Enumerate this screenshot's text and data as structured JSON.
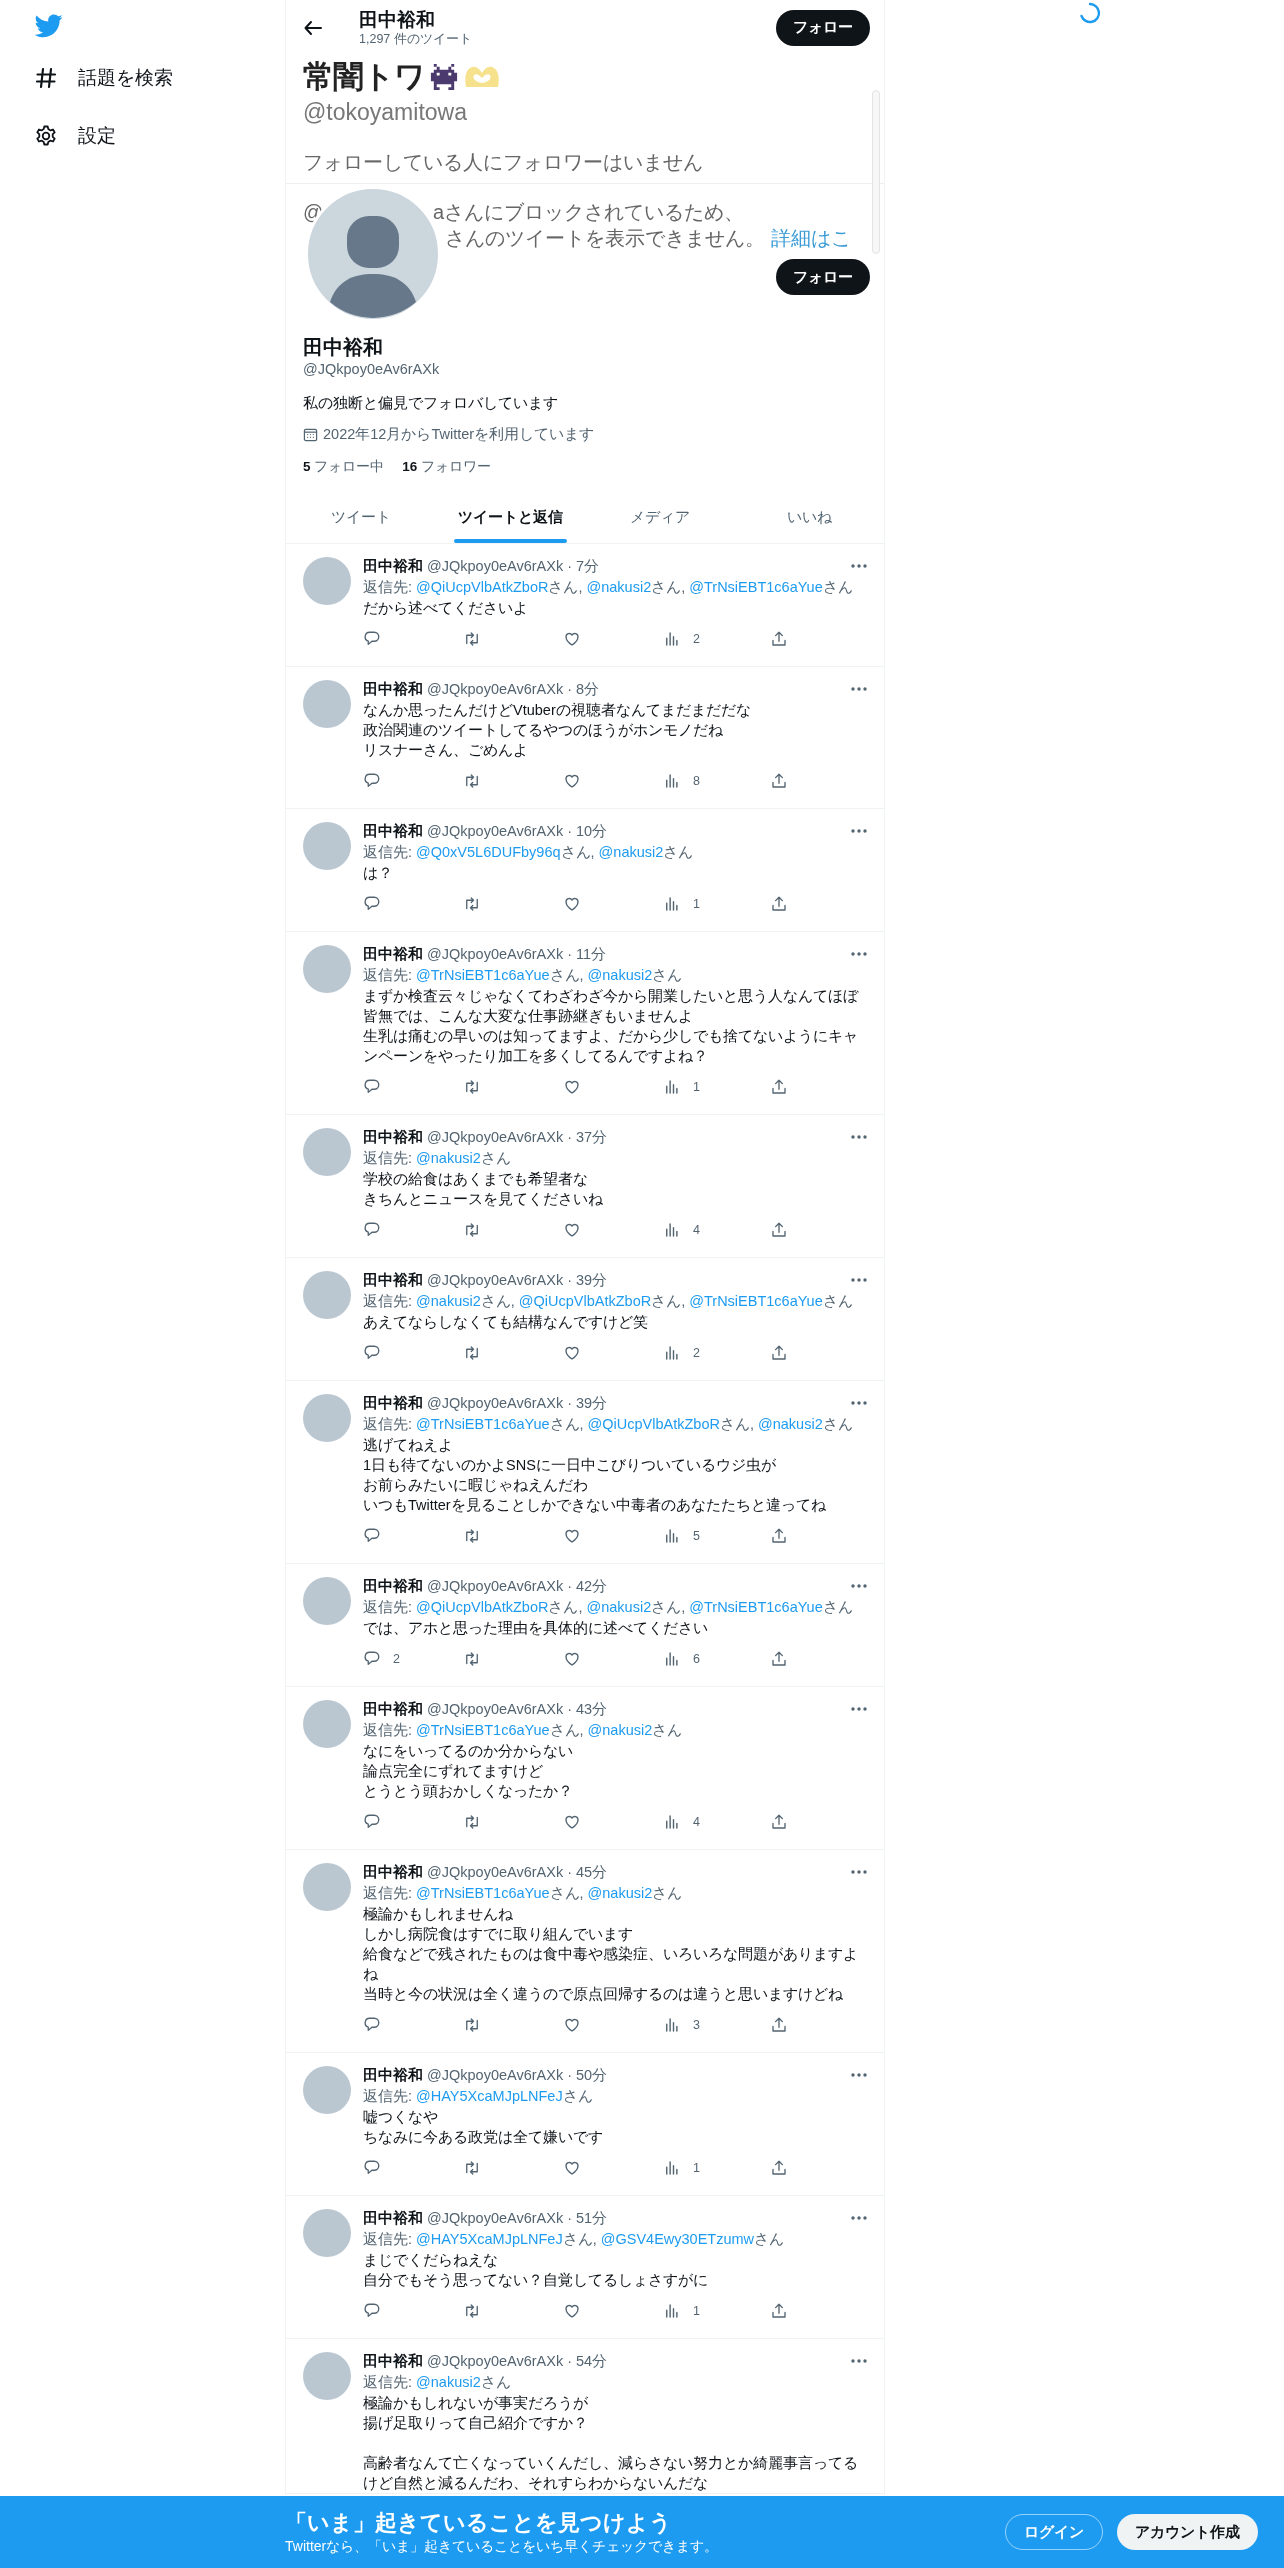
{
  "sidebar": {
    "items": [
      {
        "label": "話題を検索"
      },
      {
        "label": "設定"
      }
    ]
  },
  "header": {
    "title": "田中裕和",
    "tweet_count": "1,297 件のツイート",
    "follow_button": "フォロー"
  },
  "blocked_overlay": {
    "display_name": "常闇トワ",
    "handle": "@tokoyamitowa",
    "notice": "フォローしている人にフォロワーはいません",
    "line_1_start": "@",
    "line_1": "aさんにブロックされているため、",
    "line_2": "さんのツイートを表示できません。",
    "link": "詳細はこ"
  },
  "profile": {
    "follow_button": "フォロー",
    "name": "田中裕和",
    "handle": "@JQkpoy0eAv6rAXk",
    "bio": "私の独断と偏見でフォロバしています",
    "joined": "2022年12月からTwitterを利用しています",
    "following_count": "5",
    "following_label": "フォロー中",
    "followers_count": "16",
    "followers_label": "フォロワー"
  },
  "tabs": [
    {
      "label": "ツイート",
      "selected": false
    },
    {
      "label": "ツイートと返信",
      "selected": true
    },
    {
      "label": "メディア",
      "selected": false
    },
    {
      "label": "いいね",
      "selected": false
    }
  ],
  "tweets": [
    {
      "name": "田中裕和",
      "meta": "@JQkpoy0eAv6rAXk · 7分",
      "reply": {
        "label": "返信先:",
        "mentions": [
          {
            "handle": "@QiUcpVlbAtkZboR",
            "suffix": "さん,"
          },
          {
            "handle": "@nakusi2",
            "suffix": "さん,"
          },
          {
            "handle": "@TrNsiEBT1c6aYue",
            "suffix": "さん"
          }
        ]
      },
      "body": [
        [
          "だから述べてくださいよ"
        ]
      ],
      "views": "2"
    },
    {
      "name": "田中裕和",
      "meta": "@JQkpoy0eAv6rAXk · 8分",
      "body": [
        [
          "なんか思ったんだけどVtuberの視聴者なんてまだまだだな",
          "政治関連のツイートしてるやつのほうがホンモノだね",
          "リスナーさん、ごめんよ"
        ]
      ],
      "views": "8"
    },
    {
      "name": "田中裕和",
      "meta": "@JQkpoy0eAv6rAXk · 10分",
      "reply": {
        "label": "返信先:",
        "mentions": [
          {
            "handle": "@Q0xV5L6DUFby96q",
            "suffix": "さん,"
          },
          {
            "handle": "@nakusi2",
            "suffix": "さん"
          }
        ]
      },
      "body": [
        [
          "は？"
        ]
      ],
      "views": "1"
    },
    {
      "name": "田中裕和",
      "meta": "@JQkpoy0eAv6rAXk · 11分",
      "reply": {
        "label": "返信先:",
        "mentions": [
          {
            "handle": "@TrNsiEBT1c6aYue",
            "suffix": "さん,"
          },
          {
            "handle": "@nakusi2",
            "suffix": "さん"
          }
        ]
      },
      "body": [
        [
          "まずか検査云々じゃなくてわざわざ今から開業したいと思う人なんてほぼ皆無では、こんな大変な仕事跡継ぎもいませんよ",
          "生乳は痛むの早いのは知ってますよ、だから少しでも捨てないようにキャンペーンをやったり加工を多くしてるんですよね？"
        ]
      ],
      "views": "1"
    },
    {
      "name": "田中裕和",
      "meta": "@JQkpoy0eAv6rAXk · 37分",
      "reply": {
        "label": "返信先:",
        "mentions": [
          {
            "handle": "@nakusi2",
            "suffix": "さん"
          }
        ]
      },
      "body": [
        [
          "学校の給食はあくまでも希望者な",
          "きちんとニュースを見てくださいね"
        ]
      ],
      "views": "4"
    },
    {
      "name": "田中裕和",
      "meta": "@JQkpoy0eAv6rAXk · 39分",
      "reply": {
        "label": "返信先:",
        "mentions": [
          {
            "handle": "@nakusi2",
            "suffix": "さん,"
          },
          {
            "handle": "@QiUcpVlbAtkZboR",
            "suffix": "さん,"
          },
          {
            "handle": "@TrNsiEBT1c6aYue",
            "suffix": "さん"
          }
        ]
      },
      "body": [
        [
          "あえてならしなくても結構なんですけど笑"
        ]
      ],
      "views": "2"
    },
    {
      "name": "田中裕和",
      "meta": "@JQkpoy0eAv6rAXk · 39分",
      "reply": {
        "label": "返信先:",
        "mentions": [
          {
            "handle": "@TrNsiEBT1c6aYue",
            "suffix": "さん,"
          },
          {
            "handle": "@QiUcpVlbAtkZboR",
            "suffix": "さん,"
          },
          {
            "handle": "@nakusi2",
            "suffix": "さん"
          }
        ]
      },
      "body": [
        [
          "逃げてねえよ",
          "1日も待てないのかよSNSに一日中こびりついているウジ虫が",
          "お前らみたいに暇じゃねえんだわ",
          "いつもTwitterを見ることしかできない中毒者のあなたたちと違ってね"
        ]
      ],
      "views": "5"
    },
    {
      "name": "田中裕和",
      "meta": "@JQkpoy0eAv6rAXk · 42分",
      "reply": {
        "label": "返信先:",
        "mentions": [
          {
            "handle": "@QiUcpVlbAtkZboR",
            "suffix": "さん,"
          },
          {
            "handle": "@nakusi2",
            "suffix": "さん,"
          },
          {
            "handle": "@TrNsiEBT1c6aYue",
            "suffix": "さん"
          }
        ]
      },
      "body": [
        [
          "では、アホと思った理由を具体的に述べてください"
        ]
      ],
      "replies": "2",
      "views": "6"
    },
    {
      "name": "田中裕和",
      "meta": "@JQkpoy0eAv6rAXk · 43分",
      "reply": {
        "label": "返信先:",
        "mentions": [
          {
            "handle": "@TrNsiEBT1c6aYue",
            "suffix": "さん,"
          },
          {
            "handle": "@nakusi2",
            "suffix": "さん"
          }
        ]
      },
      "body": [
        [
          "なにをいってるのか分からない",
          "論点完全にずれてますけど",
          "とうとう頭おかしくなったか？"
        ]
      ],
      "views": "4"
    },
    {
      "name": "田中裕和",
      "meta": "@JQkpoy0eAv6rAXk · 45分",
      "reply": {
        "label": "返信先:",
        "mentions": [
          {
            "handle": "@TrNsiEBT1c6aYue",
            "suffix": "さん,"
          },
          {
            "handle": "@nakusi2",
            "suffix": "さん"
          }
        ]
      },
      "body": [
        [
          "極論かもしれませんね",
          "しかし病院食はすでに取り組んでいます",
          "給食などで残されたものは食中毒や感染症、いろいろな問題がありますよね",
          "当時と今の状況は全く違うので原点回帰するのは違うと思いますけどね"
        ]
      ],
      "views": "3"
    },
    {
      "name": "田中裕和",
      "meta": "@JQkpoy0eAv6rAXk · 50分",
      "reply": {
        "label": "返信先:",
        "mentions": [
          {
            "handle": "@HAY5XcaMJpLNFeJ",
            "suffix": "さん"
          }
        ]
      },
      "body": [
        [
          "嘘つくなや",
          "ちなみに今ある政党は全て嫌いです"
        ]
      ],
      "views": "1"
    },
    {
      "name": "田中裕和",
      "meta": "@JQkpoy0eAv6rAXk · 51分",
      "reply": {
        "label": "返信先:",
        "mentions": [
          {
            "handle": "@HAY5XcaMJpLNFeJ",
            "suffix": "さん,"
          },
          {
            "handle": "@GSV4Ewy30ETzumw",
            "suffix": "さん"
          }
        ]
      },
      "body": [
        [
          "まじでくだらねえな",
          "自分でもそう思ってない？自覚してるしょさすがに"
        ]
      ],
      "views": "1"
    },
    {
      "name": "田中裕和",
      "meta": "@JQkpoy0eAv6rAXk · 54分",
      "reply": {
        "label": "返信先:",
        "mentions": [
          {
            "handle": "@nakusi2",
            "suffix": "さん"
          }
        ]
      },
      "body": [
        [
          "極論かもしれないが事実だろうが",
          "揚げ足取りって自己紹介ですか？"
        ],
        [
          "高齢者なんて亡くなっていくんだし、減らさない努力とか綺麗事言ってるけど自然と減るんだわ、それすらわからないんだな"
        ]
      ]
    }
  ],
  "banner": {
    "title": "「いま」起きていることを見つけよう",
    "subtitle": "Twitterなら、「いま」起きていることをいち早くチェックできます。",
    "login_button": "ログイン",
    "signup_button": "アカウント作成"
  }
}
